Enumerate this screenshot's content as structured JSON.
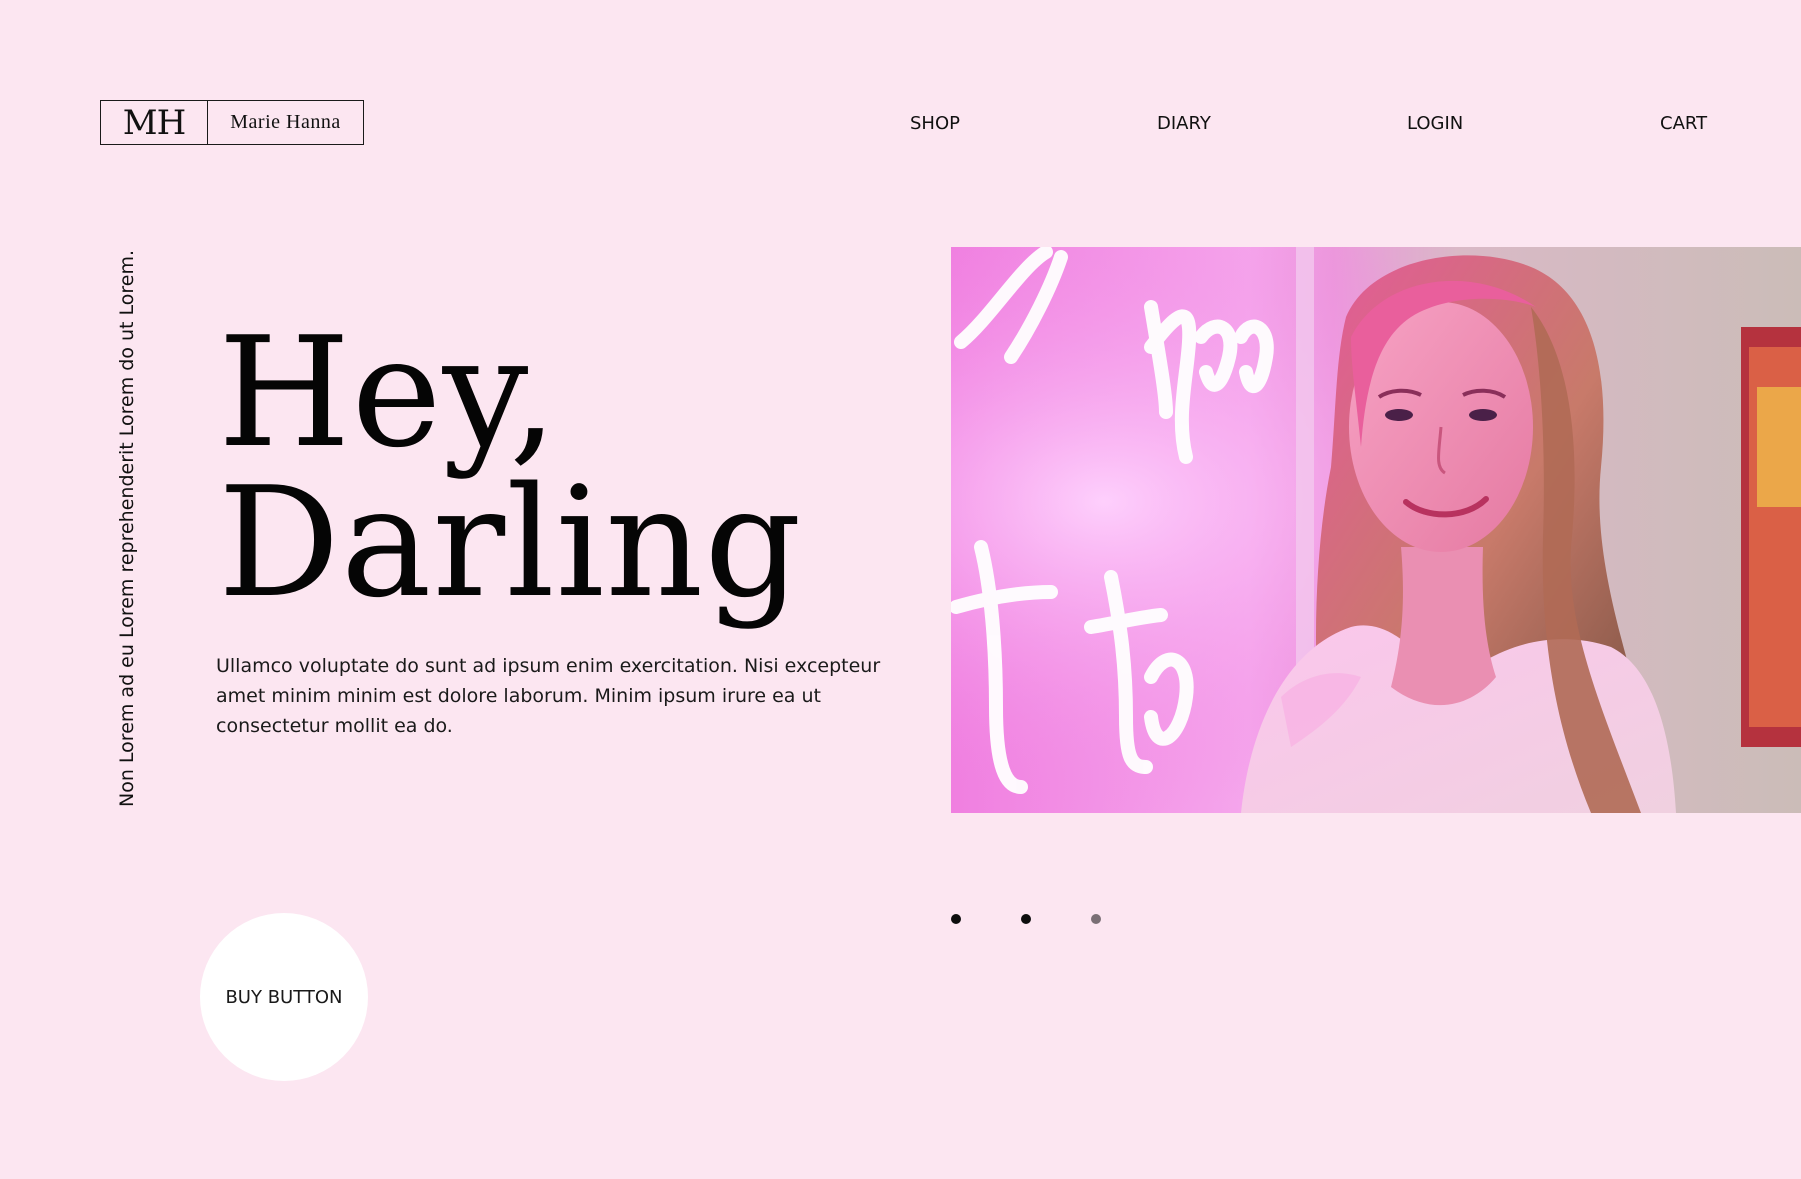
{
  "logo": {
    "mark": "MH",
    "name": "Marie Hanna"
  },
  "nav": {
    "items": [
      {
        "label": "SHOP"
      },
      {
        "label": "DIARY"
      },
      {
        "label": "LOGIN"
      },
      {
        "label": "CART"
      }
    ]
  },
  "side_text": "Non Lorem ad eu Lorem reprehenderit Lorem do ut Lorem.",
  "hero": {
    "heading_line1": "Hey,",
    "heading_line2": "Darling",
    "body": "Ullamco voluptate do sunt ad ipsum enim exercitation. Nisi excepteur amet minim minim est dolore laborum. Minim ipsum irure ea ut consectetur mollit ea do.",
    "image_icon": "portrait-photo-neon-sign"
  },
  "carousel": {
    "slide_count": 3,
    "active_index": 2
  },
  "buy_button": {
    "label": "BUY BUTTON"
  },
  "colors": {
    "background": "#fce6f1",
    "text": "#111111",
    "button_bg": "#ffffff",
    "dot_active": "#7a6f75",
    "dot_inactive": "#0d0d0d"
  }
}
